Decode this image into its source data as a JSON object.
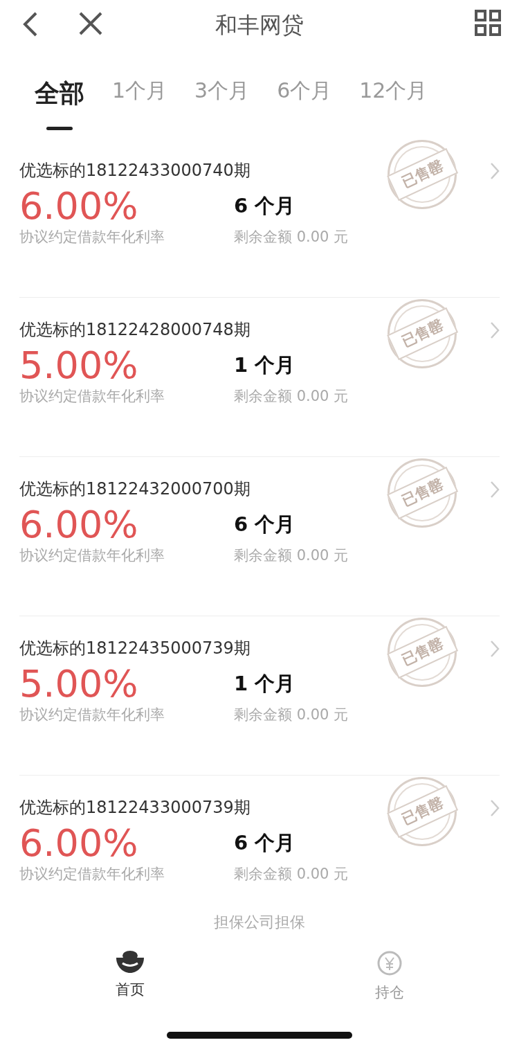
{
  "header": {
    "title": "和丰网贷"
  },
  "tabs": [
    {
      "label": "全部",
      "selected": true
    },
    {
      "label": "1个月",
      "selected": false
    },
    {
      "label": "3个月",
      "selected": false
    },
    {
      "label": "6个月",
      "selected": false
    },
    {
      "label": "12个月",
      "selected": false
    }
  ],
  "loans": [
    {
      "title": "优选标的18122433000740期",
      "rate": "6.00%",
      "rate_label": "协议约定借款年化利率",
      "term": "6 个月",
      "remaining": "剩余金额 0.00 元",
      "stamp": "已售罄"
    },
    {
      "title": "优选标的18122428000748期",
      "rate": "5.00%",
      "rate_label": "协议约定借款年化利率",
      "term": "1 个月",
      "remaining": "剩余金额 0.00 元",
      "stamp": "已售罄"
    },
    {
      "title": "优选标的18122432000700期",
      "rate": "6.00%",
      "rate_label": "协议约定借款年化利率",
      "term": "6 个月",
      "remaining": "剩余金额 0.00 元",
      "stamp": "已售罄"
    },
    {
      "title": "优选标的18122435000739期",
      "rate": "5.00%",
      "rate_label": "协议约定借款年化利率",
      "term": "1 个月",
      "remaining": "剩余金额 0.00 元",
      "stamp": "已售罄"
    },
    {
      "title": "优选标的18122433000739期",
      "rate": "6.00%",
      "rate_label": "协议约定借款年化利率",
      "term": "6 个月",
      "remaining": "剩余金额 0.00 元",
      "stamp": "已售罄"
    }
  ],
  "footer_note": "担保公司担保",
  "bottom_nav": [
    {
      "label": "首页",
      "kind": "home",
      "selected": true
    },
    {
      "label": "持仓",
      "kind": "holdings",
      "selected": false
    }
  ]
}
